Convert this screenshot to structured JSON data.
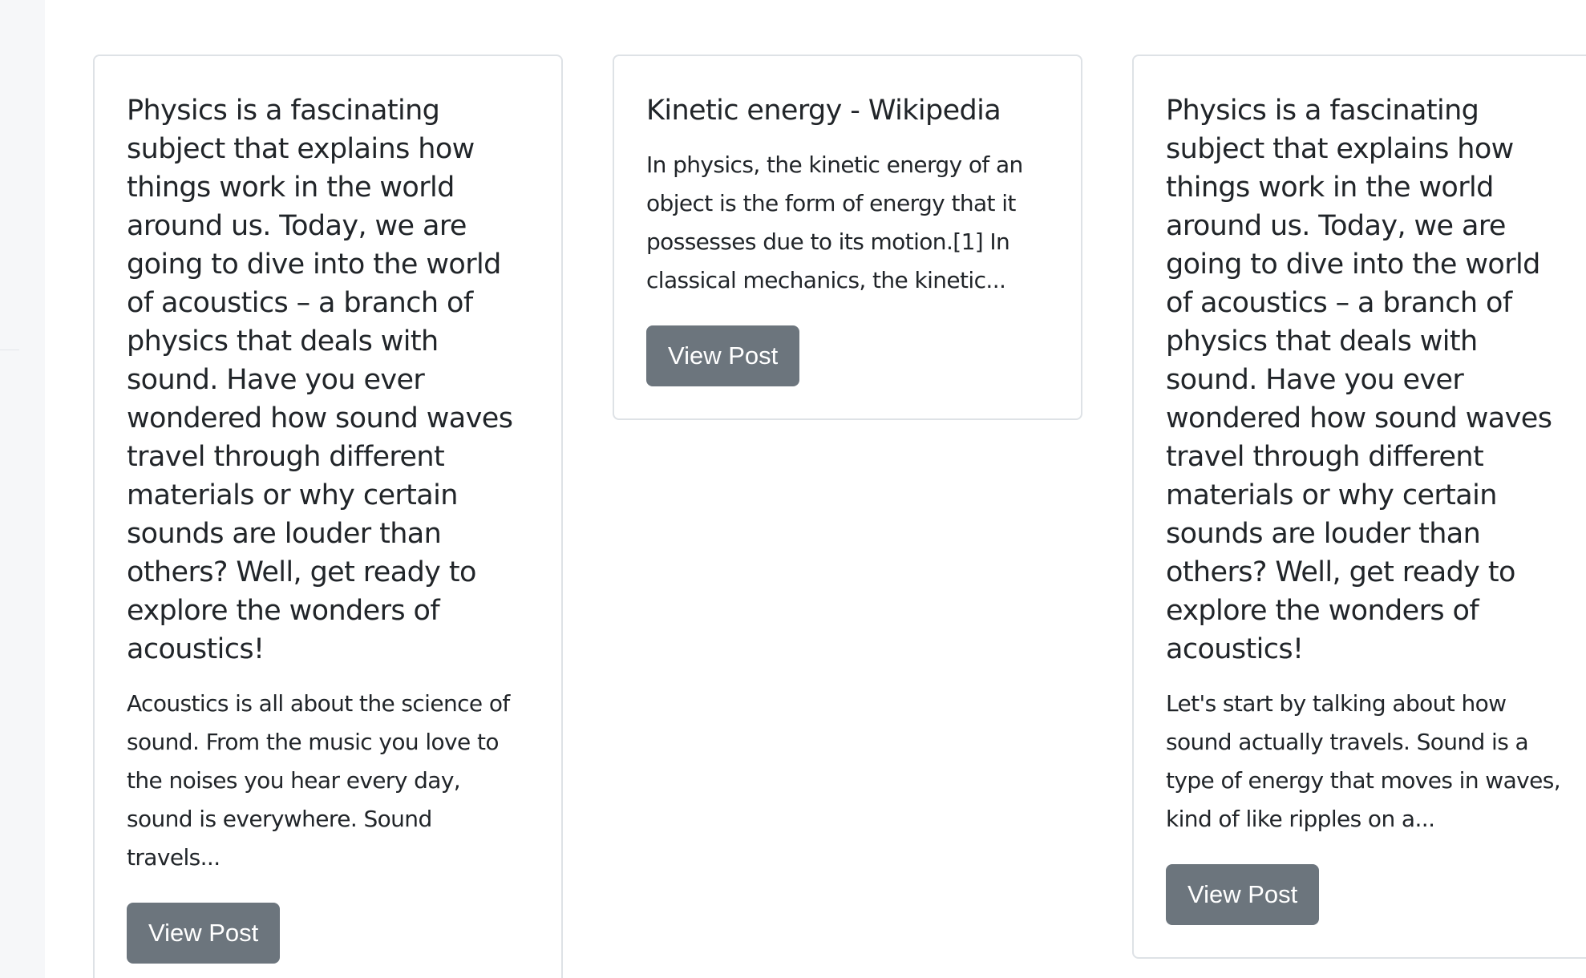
{
  "cards": [
    {
      "title": "Physics is a fascinating subject that explains how things work in the world around us. Today, we are going to dive into the world of acoustics – a branch of physics that deals with sound. Have you ever wondered how sound waves travel through different materials or why certain sounds are louder than others? Well, get ready to explore the wonders of acoustics!",
      "excerpt": "Acoustics is all about the science of sound. From the music you love to the noises you hear every day, sound is everywhere. Sound travels...",
      "button_label": "View Post"
    },
    {
      "title": "Kinetic energy - Wikipedia",
      "excerpt": "In physics, the kinetic energy of an object is the form of energy that it possesses due to its motion.[1] In classical mechanics, the kinetic...",
      "button_label": "View Post"
    },
    {
      "title": "Physics is a fascinating subject that explains how things work in the world around us. Today, we are going to dive into the world of acoustics – a branch of physics that deals with sound. Have you ever wondered how sound waves travel through different materials or why certain sounds are louder than others? Well, get ready to explore the wonders of acoustics!",
      "excerpt": "Let's start by talking about how sound actually travels. Sound is a type of energy that moves in waves, kind of like ripples on a...",
      "button_label": "View Post"
    }
  ],
  "colors": {
    "button_bg": "#6c757d",
    "card_border": "#dee2e6",
    "text": "#212529"
  }
}
